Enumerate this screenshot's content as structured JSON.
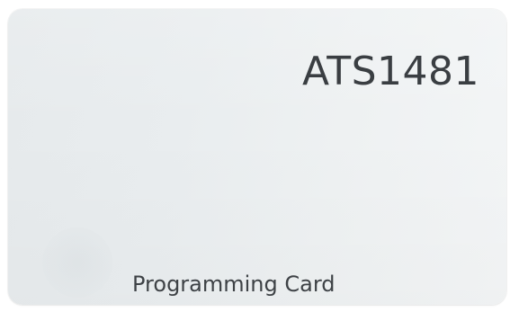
{
  "card": {
    "model": "ATS1481",
    "label": "Programming Card"
  },
  "colors": {
    "card_surface": "#eef1f2",
    "text": "#3a3e42"
  }
}
